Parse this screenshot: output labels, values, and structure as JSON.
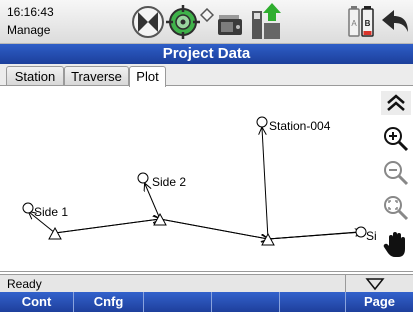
{
  "status": {
    "time": "16:16:43",
    "mode": "Manage",
    "icons": [
      "target-lock-icon",
      "prism-target-icon",
      "diamond-signal-icon",
      "instrument-icon",
      "data-transfer-icon",
      "battery-ab-icon",
      "back-arrow-icon"
    ]
  },
  "title": "Project Data",
  "tabs": [
    {
      "label": "Station",
      "active": false
    },
    {
      "label": "Traverse",
      "active": false
    },
    {
      "label": "Plot",
      "active": true
    }
  ],
  "plot": {
    "labels": {
      "station": "Station-004",
      "side2": "Side 2",
      "side1": "Side 1",
      "side3": "Si"
    },
    "tools": [
      "collapse-up-icon",
      "zoom-in-icon",
      "zoom-out-icon",
      "zoom-fit-icon",
      "pan-hand-icon"
    ]
  },
  "statusline": {
    "text": "Ready"
  },
  "softkeys": [
    {
      "label": "Cont"
    },
    {
      "label": "Cnfg"
    },
    {
      "label": ""
    },
    {
      "label": ""
    },
    {
      "label": ""
    },
    {
      "label": "Page"
    }
  ],
  "colors": {
    "titlebar": "#1c3f9b",
    "softkeys": "#1e3f9c",
    "battery_red": "#d9342b",
    "arrow_green": "#2fae2f"
  }
}
